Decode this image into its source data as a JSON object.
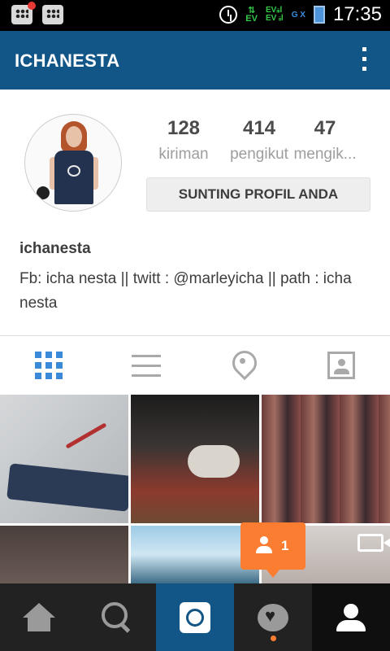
{
  "status_bar": {
    "time": "17:35",
    "network_ev": "EV",
    "signal_1": "EVᵢᵢᵢl",
    "signal_2": "EV ᵢᵢl",
    "gx": "G X"
  },
  "header": {
    "title": "ICHANESTA",
    "accent_color": "#125688"
  },
  "profile": {
    "stats": [
      {
        "value": "128",
        "label": "kiriman"
      },
      {
        "value": "414",
        "label": "pengikut"
      },
      {
        "value": "47",
        "label": "mengik..."
      }
    ],
    "edit_button": "SUNTING PROFIL ANDA",
    "username": "ichanesta",
    "bio": "Fb: icha nesta || twitt : @marleyicha || path : icha nesta"
  },
  "view_tabs": [
    "grid-icon",
    "list-icon",
    "location-pin-icon",
    "tagged-photos-icon"
  ],
  "notification": {
    "count": "1",
    "color": "#fa7d32"
  },
  "bottom_nav": [
    "home-icon",
    "search-icon",
    "camera-icon",
    "activity-icon",
    "profile-icon"
  ]
}
